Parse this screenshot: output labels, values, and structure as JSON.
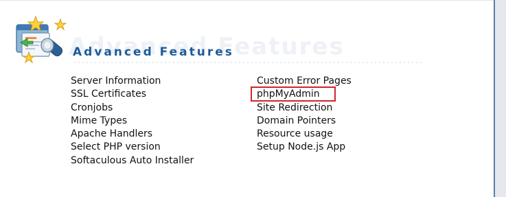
{
  "section": {
    "title": "Advanced Features",
    "watermark": "Advanced Features",
    "icon": "tools-star-icon"
  },
  "links_left": [
    {
      "label": "Server Information"
    },
    {
      "label": "SSL Certificates"
    },
    {
      "label": "Cronjobs"
    },
    {
      "label": "Mime Types"
    },
    {
      "label": "Apache Handlers"
    },
    {
      "label": "Select PHP version"
    },
    {
      "label": "Softaculous Auto Installer"
    }
  ],
  "links_right": [
    {
      "label": "Custom Error Pages"
    },
    {
      "label": "phpMyAdmin",
      "highlighted": true
    },
    {
      "label": "Site Redirection"
    },
    {
      "label": "Domain Pointers"
    },
    {
      "label": "Resource usage"
    },
    {
      "label": "Setup Node.js App"
    }
  ],
  "colors": {
    "title": "#1d5b9b",
    "highlight_border": "#d0242b",
    "link_text": "#111111",
    "frame_edge": "#5b7fa6"
  }
}
